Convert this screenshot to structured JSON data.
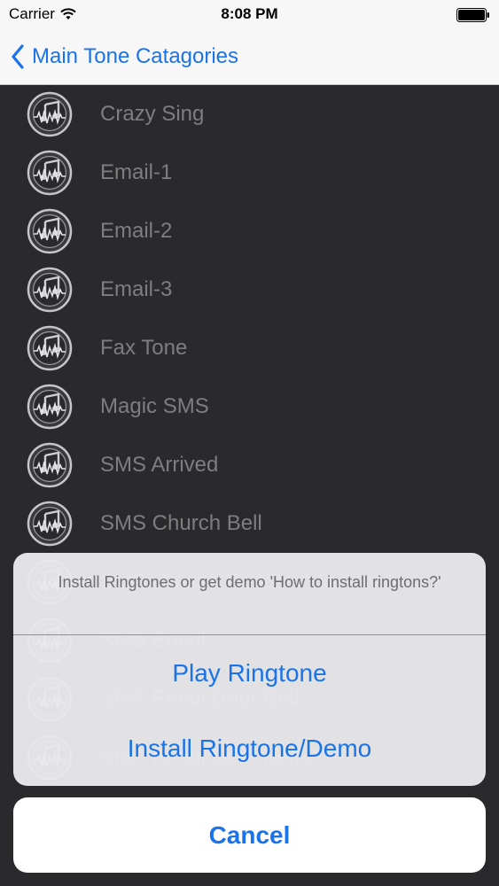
{
  "status_bar": {
    "carrier": "Carrier",
    "time": "8:08 PM"
  },
  "nav": {
    "back_label": "Main Tone Catagories"
  },
  "list": {
    "items": [
      "Crazy Sing",
      "Email-1",
      "Email-2",
      "Email-3",
      "Fax Tone",
      "Magic SMS",
      "SMS Arrived",
      "SMS Church Bell",
      "SMS Church Bell-2",
      "SMS Email",
      "SMS Email Door Bell",
      "SMS Email Door Bell-2"
    ]
  },
  "action_sheet": {
    "message": "Install Ringtones or get demo 'How to install ringtons?'",
    "actions": [
      "Play Ringtone",
      "Install Ringtone/Demo"
    ],
    "cancel": "Cancel"
  },
  "colors": {
    "accent": "#1a73e8",
    "list_background": "#2a2a2c",
    "list_text": "#7e7e80"
  }
}
